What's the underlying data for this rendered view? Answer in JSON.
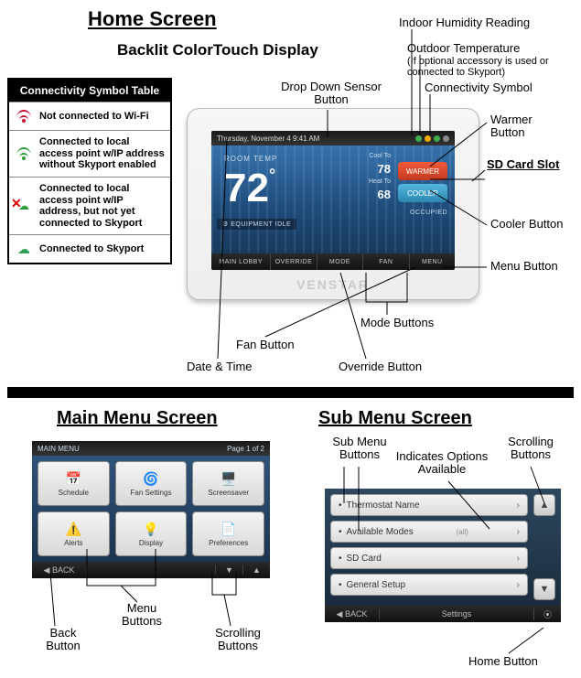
{
  "titles": {
    "home": "Home Screen",
    "display": "Backlit ColorTouch Display",
    "main_menu": "Main Menu Screen",
    "sub_menu": "Sub Menu Screen"
  },
  "conn_table": {
    "header": "Connectivity Symbol Table",
    "rows": [
      "Not connected to Wi-Fi",
      "Connected to local access point w/IP address without Skyport enabled",
      "Connected to local access point w/IP address, but not yet connected to Skyport",
      "Connected to Skyport"
    ]
  },
  "top_labels_upper": {
    "drop_down": "Drop Down Sensor Button",
    "humidity": "Indoor Humidity Reading",
    "outdoor": "Outdoor Temperature",
    "outdoor_sub": "(If optional accessory is used or connected to Skyport)",
    "conn_sym": "Connectivity Symbol"
  },
  "right_labels": {
    "warmer": "Warmer Button",
    "sd": "SD Card Slot",
    "cooler": "Cooler Button",
    "menu": "Menu Button"
  },
  "bottom_labels": {
    "mode": "Mode Buttons",
    "override": "Override Button",
    "fan": "Fan Button",
    "datetime": "Date & Time"
  },
  "device": {
    "datetime": "Thursday, November 4 9:41 AM",
    "room_label": "ROOM TEMP",
    "temp": "72",
    "deg": "°",
    "cool_to": "Cool To",
    "cool_n": "78",
    "heat_to": "Heat To",
    "heat_n": "68",
    "warmer": "WARMER",
    "cooler": "COOLER",
    "equip": "EQUIPMENT IDLE",
    "occ": "OCCUPIED",
    "bottom": [
      "MAIN LOBBY",
      "OVERRIDE",
      "MODE",
      "FAN",
      "MENU"
    ],
    "brand": "VENSTAR"
  },
  "main_menu": {
    "title": "MAIN MENU",
    "page": "Page 1 of 2",
    "icons": [
      "📅",
      "🌀",
      "🖥️",
      "⚠️",
      "💡",
      "📄"
    ],
    "buttons": [
      "Schedule",
      "Fan Settings",
      "Screensaver",
      "Alerts",
      "Display",
      "Preferences"
    ],
    "back": "◀ BACK",
    "labels": {
      "back": "Back Button",
      "menu": "Menu Buttons",
      "scroll": "Scrolling Buttons"
    }
  },
  "sub_menu": {
    "rows": [
      {
        "t": "Thermostat Name",
        "opt": "",
        "chev": "›"
      },
      {
        "t": "Available Modes",
        "opt": "(all)",
        "chev": "›"
      },
      {
        "t": "SD Card",
        "opt": "",
        "chev": "›"
      },
      {
        "t": "General Setup",
        "opt": "",
        "chev": "›"
      }
    ],
    "back": "◀ BACK",
    "title": "Settings",
    "labels": {
      "sub_btns": "Sub Menu Buttons",
      "opts": "Indicates Options Available",
      "scroll": "Scrolling Buttons",
      "home": "Home Button"
    }
  }
}
